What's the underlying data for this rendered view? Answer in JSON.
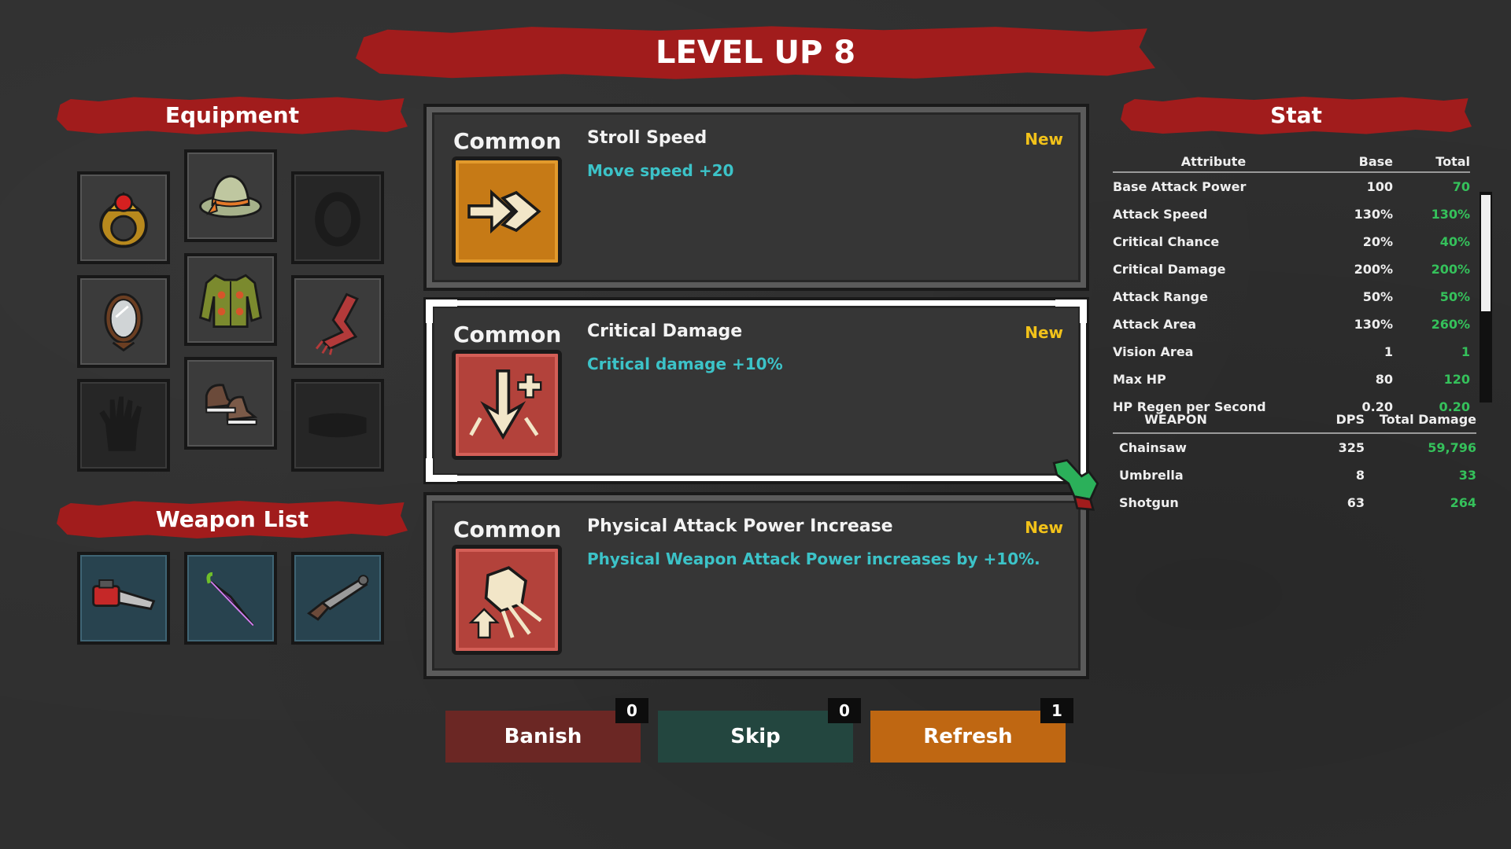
{
  "title": "LEVEL UP 8",
  "equipment": {
    "heading": "Equipment",
    "slots": [
      "ring-icon",
      "hat-icon",
      "empty-slot",
      "mirror-icon",
      "sweater-icon",
      "scarf-icon",
      "empty-glove-slot",
      "shoes-icon",
      "empty-belt-slot"
    ]
  },
  "weapon_list": {
    "heading": "Weapon List",
    "items": [
      "chainsaw-icon",
      "umbrella-icon",
      "shotgun-icon"
    ]
  },
  "cards": [
    {
      "rarity": "Common",
      "name": "Stroll Speed",
      "tag": "New",
      "desc": "Move speed +20",
      "icon": "double-arrow-icon",
      "selected": false
    },
    {
      "rarity": "Common",
      "name": "Critical Damage",
      "tag": "New",
      "desc": "Critical damage +10%",
      "icon": "critical-arrow-icon",
      "selected": true
    },
    {
      "rarity": "Common",
      "name": "Physical Attack Power Increase",
      "tag": "New",
      "desc": "Physical Weapon Attack Power increases by +10%.",
      "icon": "fist-icon",
      "selected": false
    }
  ],
  "buttons": {
    "banish": {
      "label": "Banish",
      "count": "0"
    },
    "skip": {
      "label": "Skip",
      "count": "0"
    },
    "refresh": {
      "label": "Refresh",
      "count": "1"
    }
  },
  "stat": {
    "heading": "Stat",
    "columns": [
      "Attribute",
      "Base",
      "Total"
    ],
    "rows": [
      [
        "Base Attack Power",
        "100",
        "70"
      ],
      [
        "Attack Speed",
        "130%",
        "130%"
      ],
      [
        "Critical Chance",
        "20%",
        "40%"
      ],
      [
        "Critical Damage",
        "200%",
        "200%"
      ],
      [
        "Attack Range",
        "50%",
        "50%"
      ],
      [
        "Attack Area",
        "130%",
        "260%"
      ],
      [
        "Vision Area",
        "1",
        "1"
      ],
      [
        "Max HP",
        "80",
        "120"
      ],
      [
        "HP Regen per Second",
        "0.20",
        "0.20"
      ]
    ]
  },
  "weapons_table": {
    "columns": [
      "WEAPON",
      "DPS",
      "Total Damage"
    ],
    "rows": [
      [
        "Chainsaw",
        "325",
        "59,796"
      ],
      [
        "Umbrella",
        "8",
        "33"
      ],
      [
        "Shotgun",
        "63",
        "264"
      ]
    ]
  },
  "colors": {
    "banner_red": "#a11c1c",
    "new_tag": "#f2c21a",
    "desc_cyan": "#3cc3c8",
    "total_green": "#35c15b"
  }
}
